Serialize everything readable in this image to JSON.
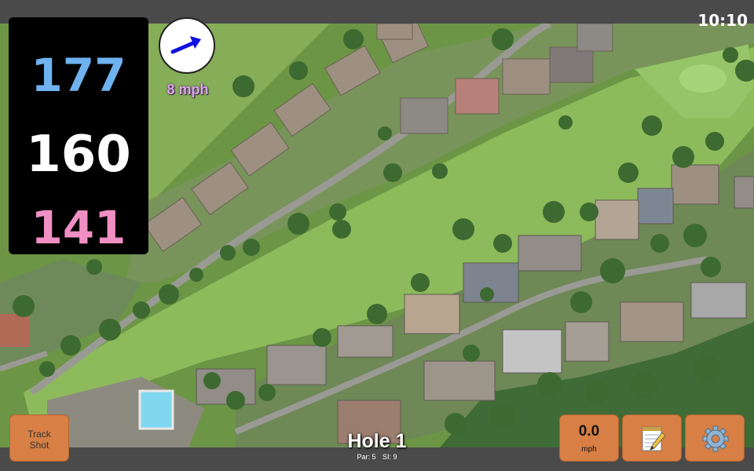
{
  "status": {
    "time": "10:10"
  },
  "distances": {
    "back": "177",
    "middle": "160",
    "front": "141"
  },
  "wind": {
    "speed_label": "8 mph",
    "arrow_icon": "wind-arrow-icon"
  },
  "hole": {
    "title": "Hole 1",
    "par_label": "Par: 5",
    "si_label": "SI: 9"
  },
  "buttons": {
    "track_shot_line1": "Track",
    "track_shot_line2": "Shot",
    "speed_value": "0.0",
    "speed_unit": "mph",
    "notes_icon": "notepad-icon",
    "settings_icon": "gear-icon"
  },
  "colors": {
    "back_distance": "#6fb2f0",
    "middle_distance": "#ffffff",
    "front_distance": "#f08fc4",
    "button_bg": "#d77f45",
    "wind_arrow": "#1010e0",
    "wind_label": "#d7a8ee"
  }
}
